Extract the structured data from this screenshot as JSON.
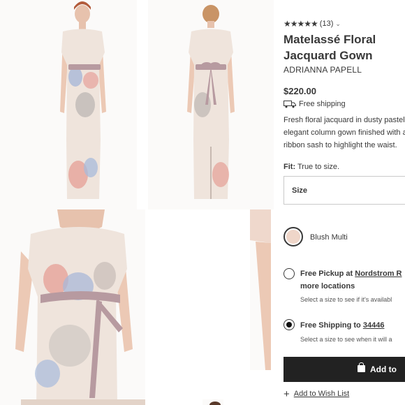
{
  "product": {
    "rating_stars": "★★★★★",
    "review_count": "(13)",
    "title": "Matelassé Floral Jacquard Gown",
    "brand": "ADRIANNA PAPELL",
    "price": "$220.00",
    "shipping_note": "Free shipping",
    "description": "Fresh floral jacquard in dusty pastels elegant column gown finished with a ribbon sash to highlight the waist.",
    "fit_label": "Fit:",
    "fit_value": "True to size.",
    "size_label": "Size",
    "color_name": "Blush Multi"
  },
  "fulfillment": {
    "pickup_prefix": "Free Pickup at",
    "pickup_store": "Nordstrom R",
    "pickup_more": "more locations",
    "pickup_hint": "Select a size to see if it's availabl",
    "shipping_prefix": "Free Shipping to",
    "shipping_zip": "34446",
    "shipping_hint": "Select a size to see when it will a"
  },
  "actions": {
    "add_to_bag": "Add to",
    "wish_list": "Add to Wish List"
  },
  "colors": {
    "button_bg": "#222222",
    "swatch": "#efd6c9",
    "gown_base": "#efe4dc",
    "sash": "#b79aa0"
  }
}
